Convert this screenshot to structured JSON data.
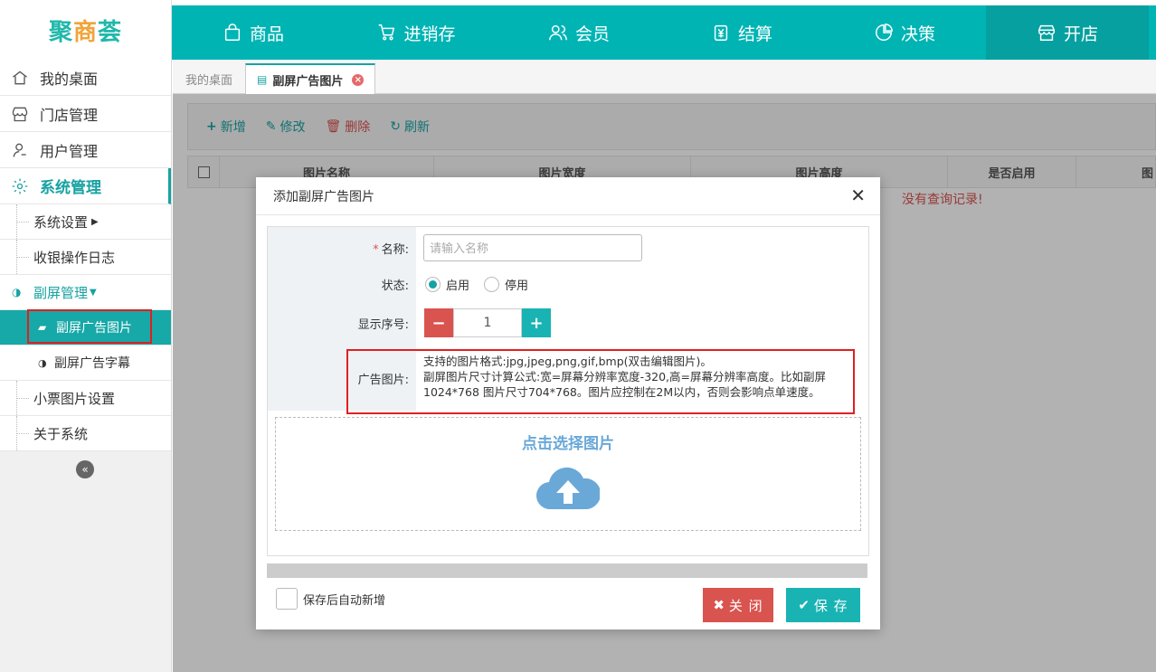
{
  "brand": {
    "name_part1": "聚",
    "name_part2": "商",
    "name_part3": "荟"
  },
  "topnav": [
    {
      "label": "商品",
      "icon": "bag-icon"
    },
    {
      "label": "进销存",
      "icon": "cart-icon"
    },
    {
      "label": "会员",
      "icon": "users-icon"
    },
    {
      "label": "结算",
      "icon": "yen-icon"
    },
    {
      "label": "决策",
      "icon": "chart-icon"
    },
    {
      "label": "开店",
      "icon": "store-icon"
    }
  ],
  "sidebar": {
    "items": [
      {
        "label": "我的桌面",
        "icon": "home-icon"
      },
      {
        "label": "门店管理",
        "icon": "shop-icon"
      },
      {
        "label": "用户管理",
        "icon": "user-icon"
      },
      {
        "label": "系统管理",
        "icon": "gear-icon"
      }
    ],
    "sub": {
      "system_settings": "系统设置",
      "cash_log": "收银操作日志",
      "second_screen": "副屏管理",
      "ad_images": "副屏广告图片",
      "ad_captions": "副屏广告字幕",
      "receipt_images": "小票图片设置",
      "about": "关于系统"
    }
  },
  "tabs": {
    "home": "我的桌面",
    "current": "副屏广告图片"
  },
  "toolbar": {
    "add": "新增",
    "edit": "修改",
    "delete": "删除",
    "refresh": "刷新"
  },
  "table": {
    "headers": [
      "图片名称",
      "图片宽度",
      "图片高度",
      "是否启用",
      "图"
    ],
    "empty": "没有查询记录!"
  },
  "modal": {
    "title": "添加副屏广告图片",
    "name_label": "名称:",
    "name_placeholder": "请输入名称",
    "status_label": "状态:",
    "status_on": "启用",
    "status_off": "停用",
    "order_label": "显示序号:",
    "order_value": "1",
    "image_label": "广告图片:",
    "image_note_1": "支持的图片格式:jpg,jpeg,png,gif,bmp(双击编辑图片)。",
    "image_note_2": "副屏图片尺寸计算公式:宽=屏幕分辨率宽度-320,高=屏幕分辨率高度。比如副屏1024*768 图片尺寸704*768。图片应控制在2M以内，否则会影响点单速度。",
    "upload_text": "点击选择图片",
    "auto_add": "保存后自动新增",
    "close_btn": "关 闭",
    "save_btn": "保 存"
  }
}
